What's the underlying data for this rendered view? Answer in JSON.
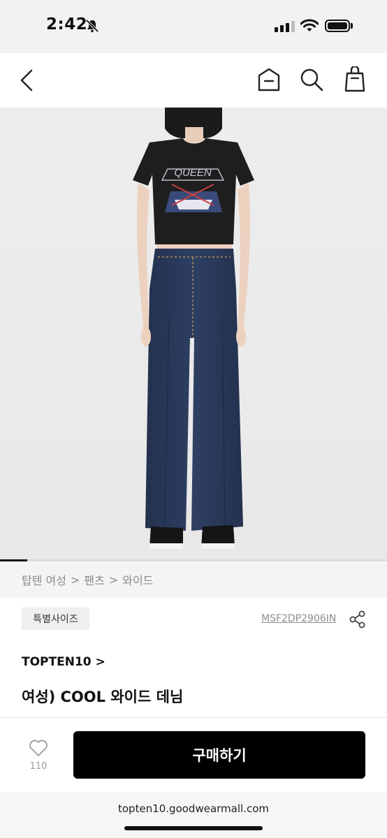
{
  "status_bar": {
    "time": "2:42",
    "battery_level": 1.0,
    "signal_bars": 3
  },
  "nav": {
    "back_icon": "chevron-left-icon",
    "home_icon": "home-icon",
    "search_icon": "search-icon",
    "cart_icon": "shopping-bag-icon"
  },
  "product_image": {
    "current_index_fraction": 0.07,
    "shirt_print": "QUEEN"
  },
  "breadcrumb": {
    "items": [
      "탑텐 여성",
      "팬츠",
      "와이드"
    ],
    "separator": ">"
  },
  "product": {
    "badge": "특별사이즈",
    "code": "MSF2DP2906IN",
    "brand": "TOPTEN10",
    "brand_arrow": ">",
    "name": "여성) COOL 와이드 데님"
  },
  "actions": {
    "like_count": "110",
    "buy_label": "구매하기"
  },
  "browser": {
    "url": "topten10.goodwearmall.com"
  },
  "colors": {
    "accent": "#000000",
    "breadcrumb_bg": "#f4f4f4",
    "denim": "#2b3b5c"
  }
}
